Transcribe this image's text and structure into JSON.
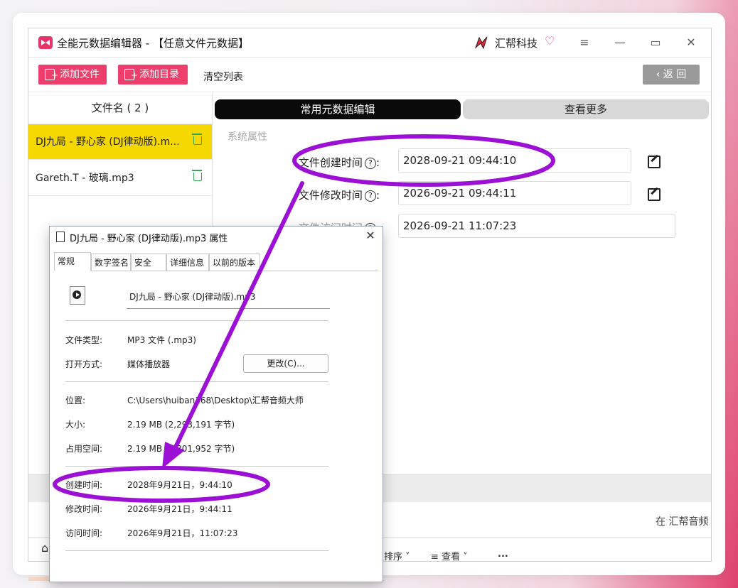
{
  "app": {
    "title": "全能元数据编辑器 - 【任意文件元数据】",
    "brand": "汇帮科技"
  },
  "toolbar": {
    "add_file": "添加文件",
    "add_dir": "添加目录",
    "clear_list": "清空列表",
    "back": "返 回"
  },
  "file_list": {
    "header": "文件名 ( 2 )",
    "items": [
      {
        "name": "DJ九局 - 野心家 (DJ律动版).m..."
      },
      {
        "name": "Gareth.T - 玻璃.mp3"
      }
    ]
  },
  "tabs": {
    "common": "常用元数据编辑",
    "more": "查看更多"
  },
  "section": "系统属性",
  "fields": [
    {
      "label": "文件创建时间",
      "value": "2028-09-21 09:44:10"
    },
    {
      "label": "文件修改时间",
      "value": "2026-09-21 09:44:11"
    },
    {
      "label": "文件访问时间",
      "value": "2026-09-21 11:07:23"
    }
  ],
  "bottom_text": "在 汇帮音频",
  "statusbar": {
    "sort": "排序",
    "view": "查看",
    "more": "..."
  },
  "dialog": {
    "title": "DJ九局 - 野心家 (DJ律动版).mp3 属性",
    "tabs": [
      "常规",
      "数字签名",
      "安全",
      "详细信息",
      "以前的版本"
    ],
    "filename": "DJ九局 - 野心家 (DJ律动版).mp3",
    "type_label": "文件类型:",
    "type_value": "MP3 文件 (.mp3)",
    "open_label": "打开方式:",
    "open_value": "媒体播放器",
    "change_button": "更改(C)...",
    "location_label": "位置:",
    "location_value": "C:\\Users\\huiban168\\Desktop\\汇帮音频大师",
    "size_label": "大小:",
    "size_value": "2.19 MB (2,293,191 字节)",
    "disk_label": "占用空间:",
    "disk_value": "2.19 MB (2,301,952 字节)",
    "created_label": "创建时间:",
    "created_value": "2028年9月21日，9:44:10",
    "modified_label": "修改时间:",
    "modified_value": "2026年9月21日，9:44:11",
    "accessed_label": "访问时间:",
    "accessed_value": "2026年9月21日，11:07:23"
  },
  "colors": {
    "accent": "#ec3f6c",
    "selected_row": "#f5d800",
    "annotation": "#9b10d4"
  }
}
